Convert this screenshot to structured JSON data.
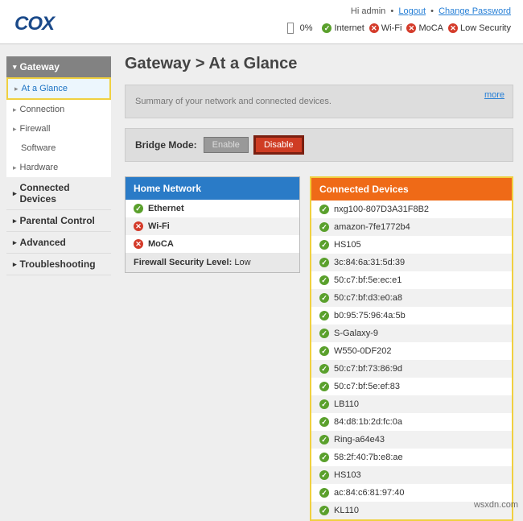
{
  "header": {
    "logo": "COX",
    "greeting": "Hi admin",
    "logout": "Logout",
    "change_pw": "Change Password",
    "battery_pct": "0%",
    "status": [
      {
        "label": "Internet",
        "ok": true
      },
      {
        "label": "Wi-Fi",
        "ok": false
      },
      {
        "label": "MoCA",
        "ok": false
      },
      {
        "label": "Low Security",
        "ok": false
      }
    ]
  },
  "sidebar": {
    "gateway_hdr": "Gateway",
    "subs": [
      {
        "label": "At a Glance",
        "active": true
      },
      {
        "label": "Connection"
      },
      {
        "label": "Firewall"
      },
      {
        "label": "Software",
        "plain": true
      },
      {
        "label": "Hardware"
      }
    ],
    "tops": [
      "Connected Devices",
      "Parental Control",
      "Advanced",
      "Troubleshooting"
    ]
  },
  "main": {
    "title": "Gateway > At a Glance",
    "summary": "Summary of your network and connected devices.",
    "more": "more",
    "bridge_label": "Bridge Mode:",
    "enable": "Enable",
    "disable": "Disable",
    "home_hdr": "Home Network",
    "home_items": [
      {
        "label": "Ethernet",
        "ok": true
      },
      {
        "label": "Wi-Fi",
        "ok": false
      },
      {
        "label": "MoCA",
        "ok": false
      }
    ],
    "fw_label": "Firewall Security Level:",
    "fw_value": "Low",
    "conn_hdr": "Connected Devices",
    "conn_items": [
      "nxg100-807D3A31F8B2",
      "amazon-7fe1772b4",
      "HS105",
      "3c:84:6a:31:5d:39",
      "50:c7:bf:5e:ec:e1",
      "50:c7:bf:d3:e0:a8",
      "b0:95:75:96:4a:5b",
      "S-Galaxy-9",
      "W550-0DF202",
      "50:c7:bf:73:86:9d",
      "50:c7:bf:5e:ef:83",
      "LB110",
      "84:d8:1b:2d:fc:0a",
      "Ring-a64e43",
      "58:2f:40:7b:e8:ae",
      "HS103",
      "ac:84:c6:81:97:40",
      "KL110"
    ]
  },
  "watermark": "wsxdn.com"
}
